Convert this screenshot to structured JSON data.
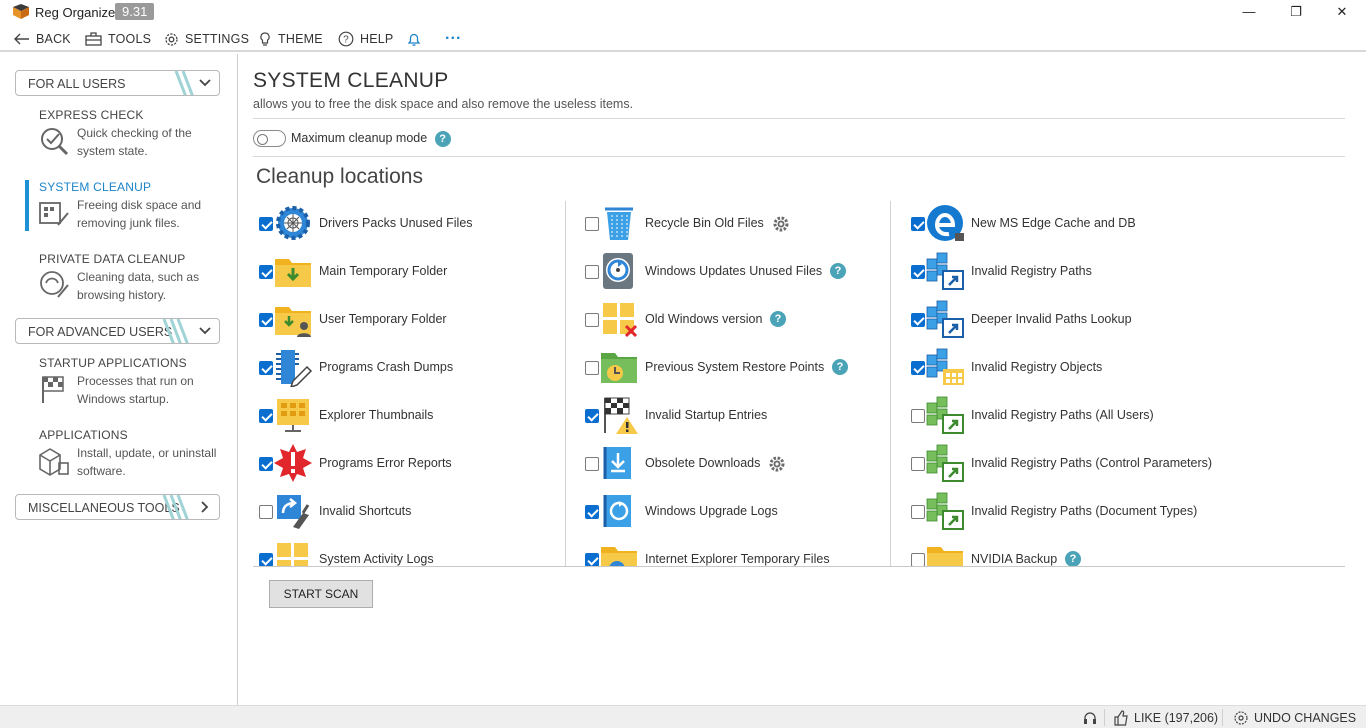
{
  "app": {
    "name": "Reg Organizer",
    "version": "9.31"
  },
  "window_controls": {
    "minimize": "—",
    "restore": "❐",
    "close": "✕"
  },
  "toolbar": {
    "back": "BACK",
    "tools": "TOOLS",
    "settings": "SETTINGS",
    "theme": "THEME",
    "help": "HELP",
    "more": "···"
  },
  "sidebar": {
    "for_all_users": "FOR ALL USERS",
    "express_check": {
      "title": "EXPRESS CHECK",
      "desc": "Quick checking of the system state."
    },
    "system_cleanup": {
      "title": "SYSTEM CLEANUP",
      "desc": "Freeing disk space and removing junk files."
    },
    "private_data": {
      "title": "PRIVATE DATA CLEANUP",
      "desc": "Cleaning data, such as browsing history."
    },
    "for_advanced_users": "FOR ADVANCED USERS",
    "startup": {
      "title": "STARTUP APPLICATIONS",
      "desc": "Processes that run on Windows startup."
    },
    "applications": {
      "title": "APPLICATIONS",
      "desc": "Install, update, or uninstall software."
    },
    "misc_tools": "MISCELLANEOUS TOOLS"
  },
  "main": {
    "title": "SYSTEM CLEANUP",
    "subtitle": "allows you to free the disk space and also remove the useless items.",
    "max_mode_label": "Maximum cleanup mode",
    "help_glyph": "?",
    "section_title": "Cleanup locations",
    "start_scan": "START SCAN",
    "columns": [
      [
        {
          "label": "Drivers Packs Unused Files",
          "checked": true,
          "icon": "gear-web-icon"
        },
        {
          "label": "Main Temporary Folder",
          "checked": true,
          "icon": "folder-download-icon"
        },
        {
          "label": "User Temporary Folder",
          "checked": true,
          "icon": "folder-user-icon"
        },
        {
          "label": "Programs Crash Dumps",
          "checked": true,
          "icon": "chip-pencil-icon"
        },
        {
          "label": "Explorer Thumbnails",
          "checked": true,
          "icon": "thumbnails-folder-icon"
        },
        {
          "label": "Programs Error Reports",
          "checked": true,
          "icon": "error-burst-icon"
        },
        {
          "label": "Invalid Shortcuts",
          "checked": false,
          "icon": "broken-shortcut-icon"
        },
        {
          "label": "System Activity Logs",
          "checked": true,
          "icon": "windows-logs-icon"
        }
      ],
      [
        {
          "label": "Recycle Bin Old Files",
          "checked": false,
          "icon": "recycle-bin-icon",
          "extra": "gear"
        },
        {
          "label": "Windows Updates Unused Files",
          "checked": false,
          "icon": "updates-disk-icon",
          "extra": "help"
        },
        {
          "label": "Old Windows version",
          "checked": false,
          "icon": "windows-x-icon",
          "extra": "help"
        },
        {
          "label": "Previous System Restore Points",
          "checked": false,
          "icon": "restore-folder-icon",
          "extra": "help"
        },
        {
          "label": "Invalid Startup Entries",
          "checked": true,
          "icon": "flag-warning-icon"
        },
        {
          "label": "Obsolete Downloads",
          "checked": false,
          "icon": "download-book-icon",
          "extra": "gear"
        },
        {
          "label": "Windows Upgrade Logs",
          "checked": true,
          "icon": "upgrade-book-icon"
        },
        {
          "label": "Internet Explorer Temporary Files",
          "checked": true,
          "icon": "ie-folder-icon"
        }
      ],
      [
        {
          "label": "New MS Edge Cache and DB",
          "checked": true,
          "icon": "edge-icon"
        },
        {
          "label": "Invalid Registry Paths",
          "checked": true,
          "icon": "registry-blue-icon"
        },
        {
          "label": "Deeper Invalid Paths Lookup",
          "checked": true,
          "icon": "registry-blue-icon"
        },
        {
          "label": "Invalid Registry Objects",
          "checked": true,
          "icon": "registry-objects-icon"
        },
        {
          "label": "Invalid Registry Paths (All Users)",
          "checked": false,
          "icon": "registry-green-icon"
        },
        {
          "label": "Invalid Registry Paths (Control Parameters)",
          "checked": false,
          "icon": "registry-green-icon"
        },
        {
          "label": "Invalid Registry Paths (Document Types)",
          "checked": false,
          "icon": "registry-green-icon"
        },
        {
          "label": "NVIDIA Backup",
          "checked": false,
          "icon": "folder-yellow-icon",
          "extra": "help"
        }
      ]
    ]
  },
  "statusbar": {
    "like": "LIKE (197,206)",
    "undo": "UNDO CHANGES"
  },
  "colors": {
    "accent": "#1e84c8",
    "checkbox_on": "#0a6ed1",
    "help": "#4aa3b7"
  }
}
